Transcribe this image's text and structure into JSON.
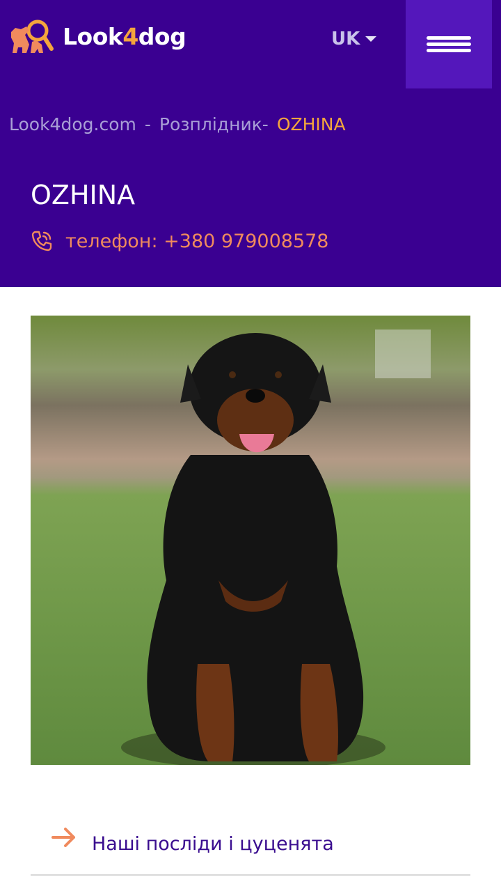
{
  "header": {
    "logo": {
      "prefix": "Look",
      "number": "4",
      "suffix": "dog"
    },
    "language": "UK",
    "menu_icon": "hamburger-icon"
  },
  "breadcrumb": {
    "items": [
      "Look4dog.com",
      "Розплідник"
    ],
    "separator": "-",
    "current": "OZHINA"
  },
  "kennel": {
    "title": "OZHINA",
    "phone_icon": "phone-icon",
    "phone": "телефон: +380 979008578"
  },
  "main": {
    "photo_icon": "rottweiler-photo",
    "links": [
      {
        "label": "Наші посліди і цуценята",
        "icon": "arrow-right-icon"
      }
    ]
  },
  "colors": {
    "header_bg": "#3a0091",
    "menu_bg": "#5417bb",
    "accent_orange": "#f4a53d",
    "phone_color": "#f08a5d",
    "link_color": "#3a0d8f"
  }
}
